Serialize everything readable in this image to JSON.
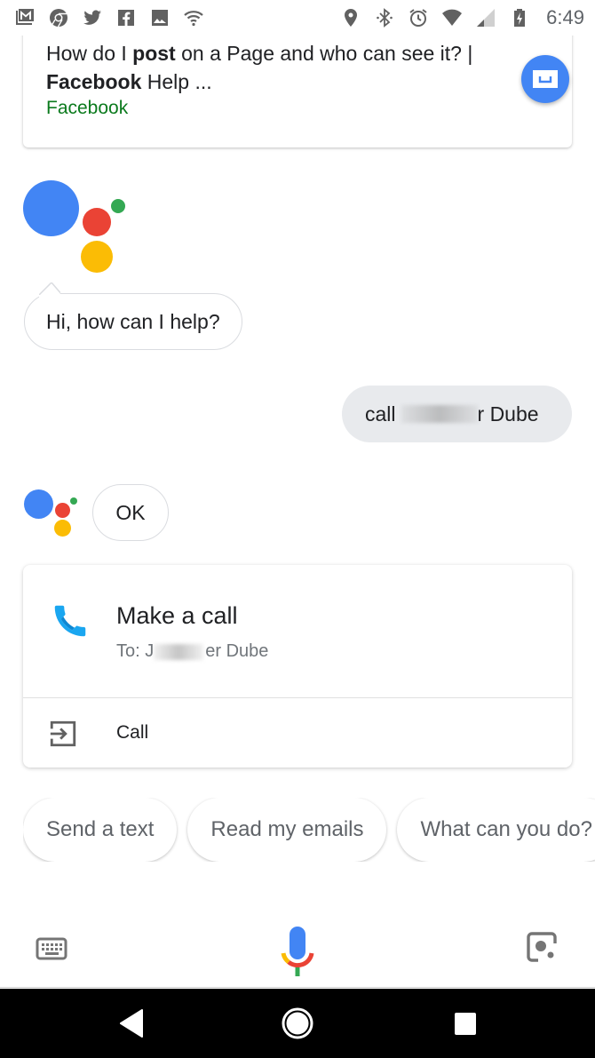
{
  "status_bar": {
    "left_icons": [
      "gmail-icon",
      "chrome-icon",
      "twitter-icon",
      "facebook-icon",
      "photos-icon",
      "wifi-icon"
    ],
    "right_icons": [
      "location-icon",
      "bluetooth-icon",
      "alarm-icon",
      "wifi-signal-icon",
      "cell-signal-icon",
      "battery-charging-icon"
    ],
    "time": "6:49"
  },
  "search_result": {
    "title_parts": [
      "How do I ",
      "post",
      " on a Page and who can see it? | ",
      "Facebook",
      " Help ..."
    ],
    "source": "Facebook"
  },
  "conversation": {
    "assistant_greeting": "Hi, how can I help?",
    "user_query_prefix": "call",
    "user_query_suffix": "r Dube",
    "assistant_reply": "OK"
  },
  "call_card": {
    "title": "Make a call",
    "to_prefix": "To: J",
    "to_suffix": "er Dube",
    "action_label": "Call"
  },
  "suggestions": [
    "Send a text",
    "Read my emails",
    "What can you do?"
  ],
  "bottom_bar": {
    "left_icon": "keyboard-icon",
    "center_icon": "mic-icon",
    "right_icon": "lens-icon"
  },
  "colors": {
    "google_blue": "#4285f4",
    "google_red": "#ea4335",
    "google_yellow": "#fbbc05",
    "google_green": "#34a853",
    "source_green": "#0b7a1d",
    "user_bubble": "#e8eaed",
    "phone_blue": "#1aa6f0"
  }
}
